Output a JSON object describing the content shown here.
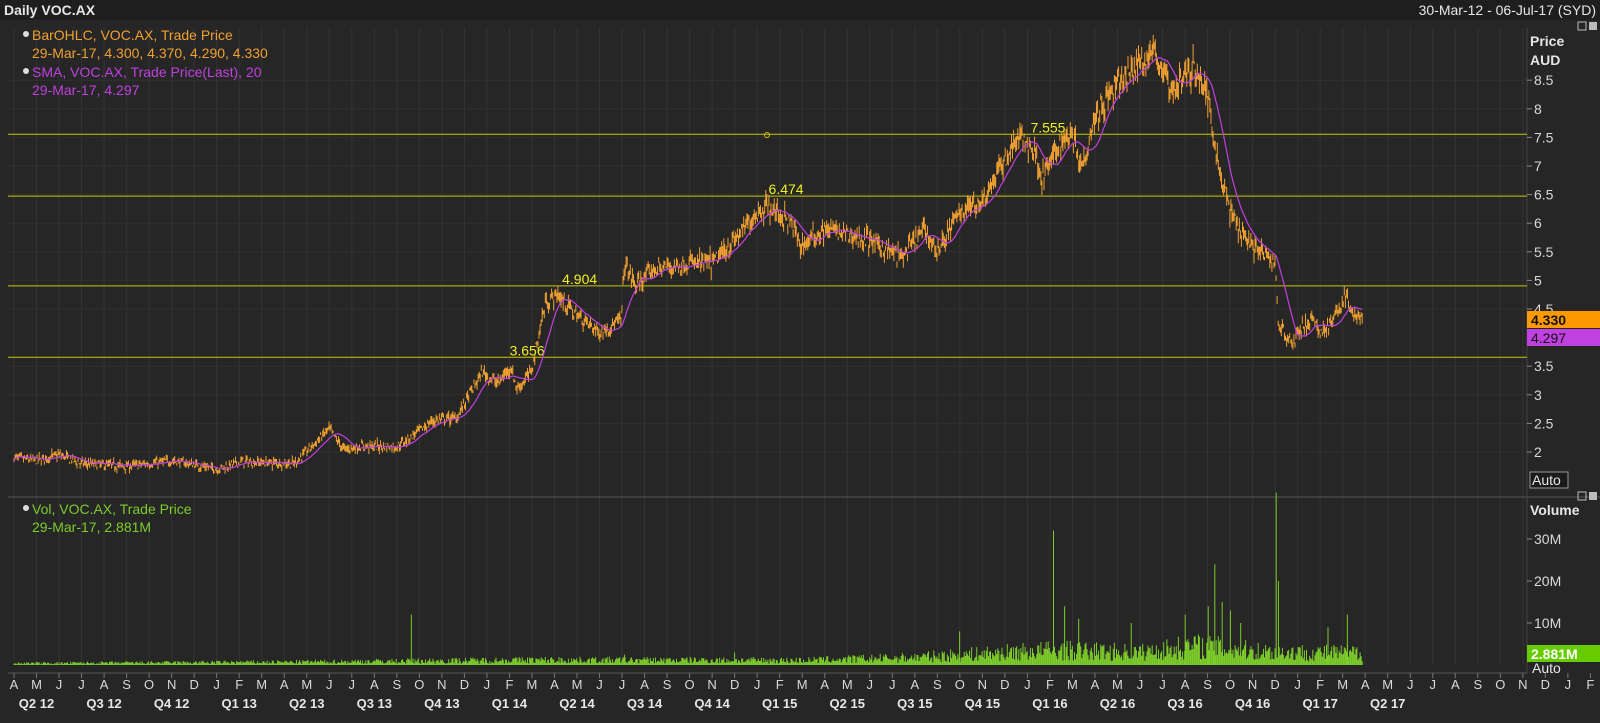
{
  "header": {
    "title": "Daily VOC.AX",
    "date_range": "30-Mar-12 - 06-Jul-17 (SYD)"
  },
  "price_panel": {
    "legend_ohlc_line1": "BarOHLC, VOC.AX, Trade Price",
    "legend_ohlc_line2": "29-Mar-17, 4.300, 4.370, 4.290, 4.330",
    "legend_sma_line1": "SMA, VOC.AX, Trade Price(Last),  20",
    "legend_sma_line2": "29-Mar-17, 4.297",
    "axis_title_1": "Price",
    "axis_title_2": "AUD",
    "last_price_tag": "4.330",
    "sma_tag": "4.297",
    "auto_button": "Auto"
  },
  "volume_panel": {
    "legend_line1": "Vol, VOC.AX, Trade Price",
    "legend_line2": "29-Mar-17, 2.881M",
    "axis_title": "Volume",
    "last_volume_tag": "2.881M",
    "auto_button": "Auto"
  },
  "colors": {
    "ohlc": "#f0a030",
    "sma": "#c040e0",
    "volume": "#7ccc2a",
    "hlines": "#c8c800",
    "last_tag_bg": "#ff9900",
    "sma_tag_bg": "#c040e0",
    "volume_tag_bg": "#66cc00"
  },
  "chart_data": [
    {
      "type": "ohlc",
      "title": "Daily VOC.AX",
      "ylabel": "Price AUD",
      "ylim": [
        1.5,
        9.1
      ],
      "y_ticks": [
        "2",
        "2.5",
        "3",
        "3.5",
        "4.5",
        "5",
        "5.5",
        "6",
        "6.5",
        "7",
        "7.5",
        "8",
        "8.5"
      ],
      "x_months": [
        "A",
        "M",
        "J",
        "J",
        "A",
        "S",
        "O",
        "N",
        "D",
        "J",
        "F",
        "M",
        "A",
        "M",
        "J",
        "J",
        "A",
        "S",
        "O",
        "N",
        "D",
        "J",
        "F",
        "M",
        "A",
        "M",
        "J",
        "J",
        "A",
        "S",
        "O",
        "N",
        "D",
        "J",
        "F",
        "M",
        "A",
        "M",
        "J",
        "J",
        "A",
        "S",
        "O",
        "N",
        "D",
        "J",
        "F",
        "M",
        "A",
        "M",
        "J",
        "J",
        "A",
        "S",
        "O",
        "N",
        "D",
        "J",
        "F",
        "M",
        "A",
        "M",
        "J",
        "J",
        "A",
        "S",
        "O",
        "N",
        "D",
        "J",
        "F",
        "M",
        "A",
        "M",
        "J",
        "J"
      ],
      "x_quarters": [
        "Q2 12",
        "Q3 12",
        "Q4 12",
        "Q1 13",
        "Q2 13",
        "Q3 13",
        "Q4 13",
        "Q1 14",
        "Q2 14",
        "Q3 14",
        "Q4 14",
        "Q1 15",
        "Q2 15",
        "Q3 15",
        "Q4 15",
        "Q1 16",
        "Q2 16",
        "Q3 16",
        "Q4 16",
        "Q1 17",
        "Q2 17"
      ],
      "horizontal_lines": [
        {
          "value": 7.555,
          "label": "7.555"
        },
        {
          "value": 6.474,
          "label": "6.474"
        },
        {
          "value": 4.904,
          "label": "4.904"
        },
        {
          "value": 3.656,
          "label": "3.656"
        }
      ],
      "price_path": [
        [
          "2012-04-01",
          1.9
        ],
        [
          "2012-05-01",
          1.85
        ],
        [
          "2012-06-01",
          1.95
        ],
        [
          "2012-07-01",
          1.8
        ],
        [
          "2012-09-01",
          1.75
        ],
        [
          "2012-11-01",
          1.85
        ],
        [
          "2013-01-01",
          1.7
        ],
        [
          "2013-02-01",
          1.83
        ],
        [
          "2013-03-01",
          1.82
        ],
        [
          "2013-04-15",
          1.8
        ],
        [
          "2013-06-01",
          2.4
        ],
        [
          "2013-06-20",
          2.05
        ],
        [
          "2013-07-15",
          2.1
        ],
        [
          "2013-09-01",
          2.1
        ],
        [
          "2013-10-20",
          2.55
        ],
        [
          "2013-11-20",
          2.6
        ],
        [
          "2013-12-25",
          3.4
        ],
        [
          "2014-01-15",
          3.2
        ],
        [
          "2014-02-01",
          3.5
        ],
        [
          "2014-02-10",
          3.1
        ],
        [
          "2014-03-01",
          3.4
        ],
        [
          "2014-03-20",
          4.6
        ],
        [
          "2014-04-05",
          4.75
        ],
        [
          "2014-05-01",
          4.4
        ],
        [
          "2014-06-01",
          4.1
        ],
        [
          "2014-07-01",
          4.3
        ],
        [
          "2014-07-05",
          5.3
        ],
        [
          "2014-07-20",
          4.9
        ],
        [
          "2014-08-15",
          5.2
        ],
        [
          "2014-10-01",
          5.3
        ],
        [
          "2014-11-01",
          5.3
        ],
        [
          "2014-12-01",
          5.7
        ],
        [
          "2015-01-01",
          6.2
        ],
        [
          "2015-01-15",
          6.3
        ],
        [
          "2015-02-15",
          6.0
        ],
        [
          "2015-03-01",
          5.6
        ],
        [
          "2015-04-01",
          5.9
        ],
        [
          "2015-06-01",
          5.7
        ],
        [
          "2015-07-15",
          5.4
        ],
        [
          "2015-08-15",
          5.9
        ],
        [
          "2015-09-01",
          5.5
        ],
        [
          "2015-10-01",
          6.2
        ],
        [
          "2015-11-01",
          6.4
        ],
        [
          "2015-12-01",
          7.1
        ],
        [
          "2015-12-20",
          7.5
        ],
        [
          "2016-01-10",
          7.3
        ],
        [
          "2016-01-20",
          6.8
        ],
        [
          "2016-02-15",
          7.4
        ],
        [
          "2016-03-01",
          7.6
        ],
        [
          "2016-03-15",
          7.0
        ],
        [
          "2016-04-01",
          7.9
        ],
        [
          "2016-05-01",
          8.4
        ],
        [
          "2016-06-01",
          8.8
        ],
        [
          "2016-06-20",
          9.0
        ],
        [
          "2016-07-01",
          8.7
        ],
        [
          "2016-07-15",
          8.3
        ],
        [
          "2016-08-01",
          8.6
        ],
        [
          "2016-08-15",
          8.7
        ],
        [
          "2016-09-01",
          8.2
        ],
        [
          "2016-09-15",
          7.0
        ],
        [
          "2016-10-01",
          6.2
        ],
        [
          "2016-10-15",
          5.9
        ],
        [
          "2016-11-01",
          5.6
        ],
        [
          "2016-11-20",
          5.4
        ],
        [
          "2016-12-01",
          5.3
        ],
        [
          "2016-12-05",
          4.2
        ],
        [
          "2016-12-25",
          3.9
        ],
        [
          "2017-01-01",
          4.1
        ],
        [
          "2017-01-20",
          4.3
        ],
        [
          "2017-02-01",
          4.1
        ],
        [
          "2017-02-20",
          4.35
        ],
        [
          "2017-03-05",
          4.75
        ],
        [
          "2017-03-15",
          4.4
        ],
        [
          "2017-03-29",
          4.33
        ]
      ],
      "last_bar": {
        "date": "2017-03-29",
        "open": 4.3,
        "high": 4.37,
        "low": 4.29,
        "close": 4.33
      },
      "sma": {
        "period": 20,
        "last": 4.297
      }
    },
    {
      "type": "bar",
      "title": "Vol, VOC.AX, Trade Price",
      "ylabel": "Volume",
      "y_ticks": [
        "10M",
        "20M",
        "30M"
      ],
      "ylim": [
        0,
        42000000
      ],
      "baseline_by_period": [
        [
          "2012-04-01",
          400000
        ],
        [
          "2013-04-01",
          700000
        ],
        [
          "2014-03-01",
          1200000
        ],
        [
          "2015-03-01",
          1100000
        ],
        [
          "2015-08-01",
          1800000
        ],
        [
          "2016-02-01",
          3500000
        ],
        [
          "2016-06-01",
          3000000
        ],
        [
          "2016-08-15",
          4500000
        ],
        [
          "2016-12-01",
          3000000
        ],
        [
          "2017-03-29",
          2881000
        ]
      ],
      "spikes": [
        [
          "2013-09-20",
          12000000
        ],
        [
          "2014-07-05",
          2500000
        ],
        [
          "2014-12-01",
          3000000
        ],
        [
          "2015-10-01",
          8000000
        ],
        [
          "2016-02-05",
          32000000
        ],
        [
          "2016-02-20",
          14000000
        ],
        [
          "2016-03-10",
          11000000
        ],
        [
          "2016-05-20",
          10000000
        ],
        [
          "2016-08-01",
          12000000
        ],
        [
          "2016-09-01",
          14000000
        ],
        [
          "2016-09-10",
          24000000
        ],
        [
          "2016-09-20",
          15000000
        ],
        [
          "2016-10-01",
          13000000
        ],
        [
          "2016-10-15",
          10000000
        ],
        [
          "2016-12-02",
          41000000
        ],
        [
          "2016-12-05",
          20000000
        ],
        [
          "2017-02-10",
          9000000
        ],
        [
          "2017-03-08",
          12000000
        ]
      ],
      "last": {
        "date": "2017-03-29",
        "value": "2.881M"
      }
    }
  ]
}
